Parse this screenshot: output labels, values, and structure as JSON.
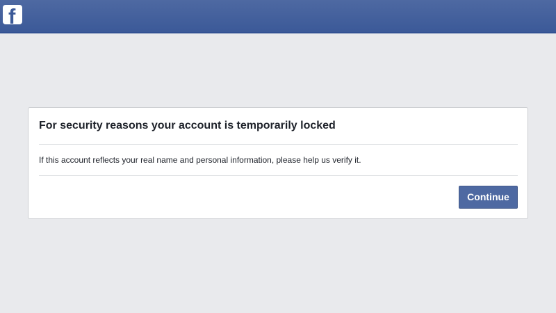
{
  "header": {
    "logo_letter": "f",
    "brand_color": "#3b5998"
  },
  "dialog": {
    "title": "For security reasons your account is temporarily locked",
    "message": "If this account reflects your real name and personal information, please help us verify it.",
    "continue_label": "Continue"
  },
  "colors": {
    "page_background": "#e9eaed",
    "button": "#4e69a2"
  },
  "icons": {
    "logo": "facebook-logo-icon"
  }
}
